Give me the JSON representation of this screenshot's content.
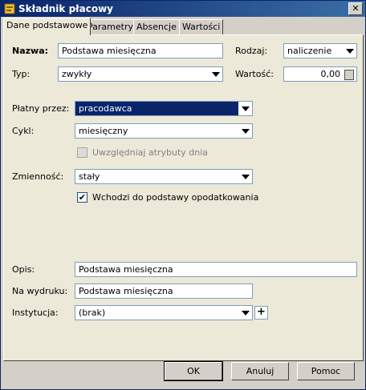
{
  "window": {
    "title": "Składnik płacowy"
  },
  "tabs": [
    "Dane podstawowe",
    "Parametry",
    "Absencje",
    "Wartości"
  ],
  "form": {
    "nazwa_label": "Nazwa:",
    "nazwa_value": "Podstawa miesięczna",
    "rodzaj_label": "Rodzaj:",
    "rodzaj_value": "naliczenie",
    "typ_label": "Typ:",
    "typ_value": "zwykły",
    "wartosc_label": "Wartość:",
    "wartosc_value": "0,00",
    "platny_label": "Płatny przez:",
    "platny_value": "pracodawca",
    "cykl_label": "Cykl:",
    "cykl_value": "miesięczny",
    "uwzgl_label": "Uwzględniaj atrybuty dnia",
    "zmiennosc_label": "Zmienność:",
    "zmiennosc_value": "stały",
    "wchodzi_label": "Wchodzi do podstawy opodatkowania",
    "opis_label": "Opis:",
    "opis_value": "Podstawa miesięczna",
    "wydruk_label": "Na wydruku:",
    "wydruk_value": "Podstawa miesięczna",
    "instytucja_label": "Instytucja:",
    "instytucja_value": "(brak)"
  },
  "buttons": {
    "ok": "OK",
    "cancel": "Anuluj",
    "help": "Pomoc"
  },
  "icons": {
    "close": "close-icon",
    "calculator": "calculator-icon",
    "plus": "plus-icon",
    "check": "check-icon"
  }
}
